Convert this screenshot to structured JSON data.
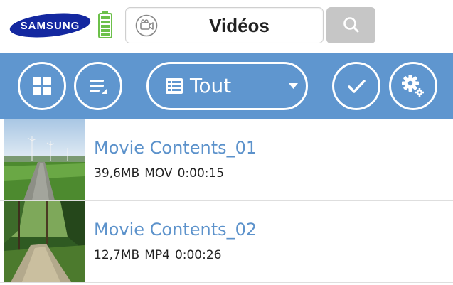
{
  "header": {
    "brand": "SAMSUNG",
    "title": "Vidéos",
    "brand_color": "#1428a0",
    "battery_color": "#6cc04a",
    "search_button_color": "#c6c6c6"
  },
  "toolbar": {
    "background": "#5f96cf",
    "buttons": [
      {
        "icon": "grid-view-icon"
      },
      {
        "icon": "list-sort-icon"
      },
      {
        "icon": "checkmark-icon"
      },
      {
        "icon": "settings-icon"
      }
    ],
    "filter": {
      "icon": "list-filter-icon",
      "selected": "Tout"
    }
  },
  "videos": [
    {
      "title": "Movie Contents_01",
      "size": "39,6MB",
      "format": "MOV",
      "duration": "0:00:15"
    },
    {
      "title": "Movie Contents_02",
      "size": "12,7MB",
      "format": "MP4",
      "duration": "0:00:26"
    }
  ],
  "colors": {
    "link_title": "#5c92cb",
    "divider": "#dedede"
  }
}
